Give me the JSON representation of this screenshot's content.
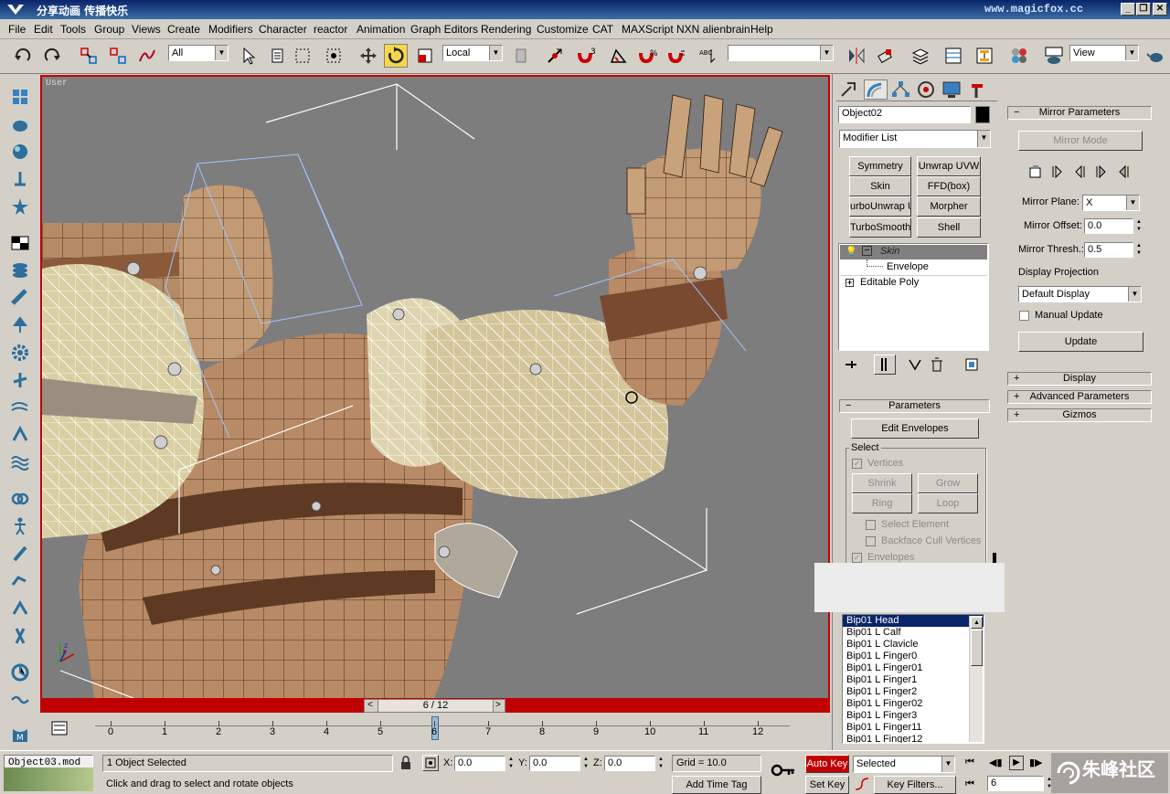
{
  "titlebar": {
    "title": "分享动画  传播快乐",
    "site": "www.magicfox.cc",
    "min": "_",
    "restore": "❐",
    "close": "✕"
  },
  "menu": [
    "File",
    "Edit",
    "Tools",
    "Group",
    "Views",
    "Create",
    "Modifiers",
    "Character",
    "reactor",
    "Animation",
    "Graph Editors",
    "Rendering",
    "Customize",
    "CAT",
    "MAXScript",
    "NXN alienbrain",
    "Help"
  ],
  "toolbar": {
    "selection_filter": "All",
    "ref_coord": "Local",
    "named_selection": "",
    "view_dropdown": "View"
  },
  "viewport": {
    "label": "User",
    "axis_labels": [
      "x",
      "y",
      "z"
    ]
  },
  "time_slider": {
    "label": "6 / 12",
    "prev": "<",
    "next": ">"
  },
  "timeline": {
    "ticks": [
      "0",
      "1",
      "2",
      "3",
      "4",
      "5",
      "6",
      "7",
      "8",
      "9",
      "10",
      "11",
      "12"
    ],
    "current": 6
  },
  "command_panel": {
    "object_name": "Object02",
    "object_color": "#000000",
    "modifier_list": "Modifier List",
    "modifier_buttons": [
      "Symmetry",
      "Unwrap UVW",
      "Skin",
      "FFD(box)",
      "urboUnwrap UV",
      "Morpher",
      "TurboSmooth",
      "Shell"
    ],
    "stack": {
      "skin": "Skin",
      "envelope": "Envelope",
      "editable_poly": "Editable Poly"
    },
    "parameters": {
      "header": "Parameters",
      "edit_envelopes": "Edit Envelopes",
      "select_label": "Select",
      "vertices": "Vertices",
      "shrink": "Shrink",
      "grow": "Grow",
      "ring": "Ring",
      "loop": "Loop",
      "select_element": "Select Element",
      "backface_cull": "Backface Cull Vertices",
      "envelopes": "Envelopes"
    },
    "bones": [
      "Bip01 Head",
      "Bip01 L Calf",
      "Bip01 L Clavicle",
      "Bip01 L Finger0",
      "Bip01 L Finger01",
      "Bip01 L Finger1",
      "Bip01 L Finger2",
      "Bip01 L Finger02",
      "Bip01 L Finger3",
      "Bip01 L Finger11",
      "Bip01 L Finger12"
    ],
    "mirror": {
      "header": "Mirror Parameters",
      "mirror_mode": "Mirror Mode",
      "mirror_plane_label": "Mirror Plane:",
      "mirror_plane_value": "X",
      "mirror_offset_label": "Mirror Offset:",
      "mirror_offset_value": "0.0",
      "mirror_thresh_label": "Mirror Thresh.:",
      "mirror_thresh_value": "0.5",
      "display_projection_label": "Display Projection",
      "display_projection_value": "Default Display",
      "manual_update": "Manual Update",
      "update": "Update"
    },
    "rollouts": [
      "Display",
      "Advanced Parameters",
      "Gizmos"
    ]
  },
  "statusbar": {
    "maxscript": "Object03.mod",
    "objects_selected": "1 Object Selected",
    "prompt": "Click and drag to select and rotate objects",
    "x_label": "X:",
    "x": "0.0",
    "y_label": "Y:",
    "y": "0.0",
    "z_label": "Z:",
    "z": "0.0",
    "grid": "Grid = 10.0",
    "add_time_tag": "Add Time Tag",
    "auto_key": "Auto Key",
    "set_key": "Set Key",
    "selected": "Selected",
    "key_filters": "Key Filters...",
    "frame": "6",
    "watermark": "朱峰社区"
  },
  "colors": {
    "accent_red": "#c00000",
    "titlebar": "#0a246a",
    "selection": "#0a246a"
  }
}
